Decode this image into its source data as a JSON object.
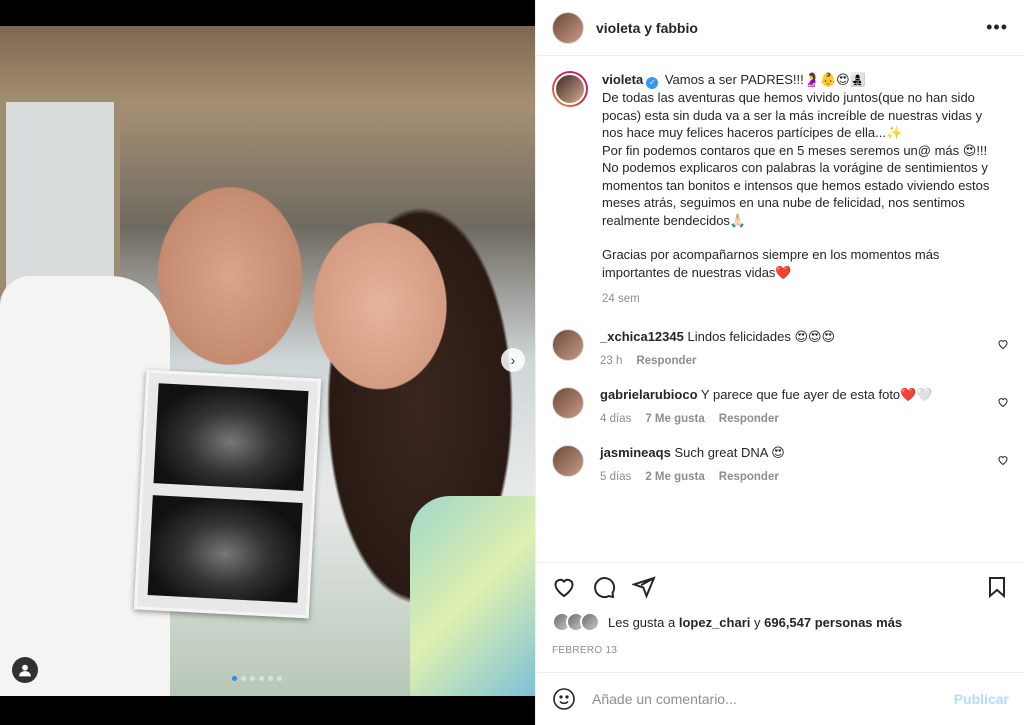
{
  "post": {
    "header_username": "violeta y fabbio",
    "more_icon": "more-horizontal-icon"
  },
  "caption": {
    "username": "violeta",
    "lines": [
      "Vamos a ser PADRES!!!🤰👶😍👩‍👧‍👦",
      "De todas las aventuras que hemos vivido juntos(que no han sido pocas) esta sin duda va a ser la más increíble de nuestras vidas y nos hace muy felices haceros partícipes de ella...✨",
      "Por fin podemos contaros que en 5 meses seremos un@ más 😍!!!",
      "No podemos explicaros con palabras la vorágine de sentimientos y momentos tan bonitos e intensos que hemos estado viviendo estos meses atrás, seguimos en una nube de felicidad, nos sentimos realmente bendecidos🙏🏻",
      "Gracias por acompañarnos siempre en los momentos más importantes de nuestras vidas❤️"
    ],
    "time": "24 sem"
  },
  "comments": [
    {
      "username": "_xchica12345",
      "text": "Lindos felicidades 😍😍😍",
      "time": "23 h",
      "likes": "",
      "reply": "Responder"
    },
    {
      "username": "gabrielarubioco",
      "text": "Y parece que fue ayer de esta foto❤️🤍",
      "time": "4 días",
      "likes": "7 Me gusta",
      "reply": "Responder"
    },
    {
      "username": "jasmineaqs",
      "text": "Such great DNA 😍",
      "time": "5 días",
      "likes": "2 Me gusta",
      "reply": "Responder"
    }
  ],
  "likes": {
    "prefix": "Les gusta a",
    "user": "lopez_chari",
    "connector": "y",
    "count": "696,547 personas más"
  },
  "date": "FEBRERO 13",
  "composer": {
    "placeholder": "Añade un comentario...",
    "post_label": "Publicar"
  },
  "carousel": {
    "slide_count": 6,
    "active_index": 0
  }
}
